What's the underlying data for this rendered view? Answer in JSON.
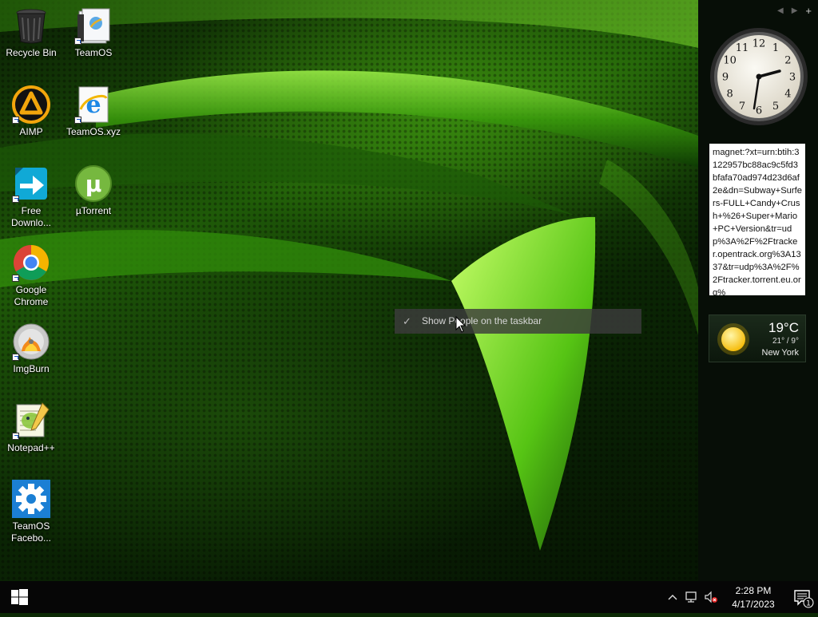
{
  "desktop": {
    "icons": [
      {
        "label": "Recycle Bin",
        "icon": "recycle-bin-icon"
      },
      {
        "label": "TeamOS",
        "icon": "folder-icon"
      },
      {
        "label": "AIMP",
        "icon": "aimp-icon"
      },
      {
        "label": "TeamOS.xyz",
        "icon": "internet-explorer-icon"
      },
      {
        "label": "Free Downlo...",
        "icon": "free-download-manager-icon"
      },
      {
        "label": "µTorrent",
        "icon": "utorrent-icon"
      },
      {
        "label": "Google Chrome",
        "icon": "chrome-icon"
      },
      {
        "label": "ImgBurn",
        "icon": "imgburn-icon"
      },
      {
        "label": "Notepad++",
        "icon": "notepad-plus-plus-icon"
      },
      {
        "label": "TeamOS Facebo...",
        "icon": "gear-icon"
      }
    ]
  },
  "context_menu": {
    "item": "Show People on the taskbar",
    "checked": true
  },
  "gadgets": {
    "clock": {
      "numerals": [
        "12",
        "1",
        "2",
        "3",
        "4",
        "5",
        "6",
        "7",
        "8",
        "9",
        "10",
        "11"
      ],
      "time": "2:28"
    },
    "magnet_text": "magnet:?xt=urn:btih:3122957bc88ac9c5fd3bfafa70ad974d23d6af2e&dn=Subway+Surfers-FULL+Candy+Crush+%26+Super+Mario+PC+Version&tr=udp%3A%2F%2Ftracker.opentrack.org%3A1337&tr=udp%3A%2F%2Ftracker.torrent.eu.org%",
    "weather": {
      "temp": "19°C",
      "range": "21° / 9°",
      "city": "New York"
    }
  },
  "taskbar": {
    "time": "2:28 PM",
    "date": "4/17/2023",
    "notification_count": "1",
    "tray_icons": [
      "chevron-up-icon",
      "network-icon",
      "volume-muted-icon"
    ]
  },
  "colors": {
    "accent_green": "#7be02a",
    "taskbar": "#060606",
    "sidebar": "#070e07"
  }
}
